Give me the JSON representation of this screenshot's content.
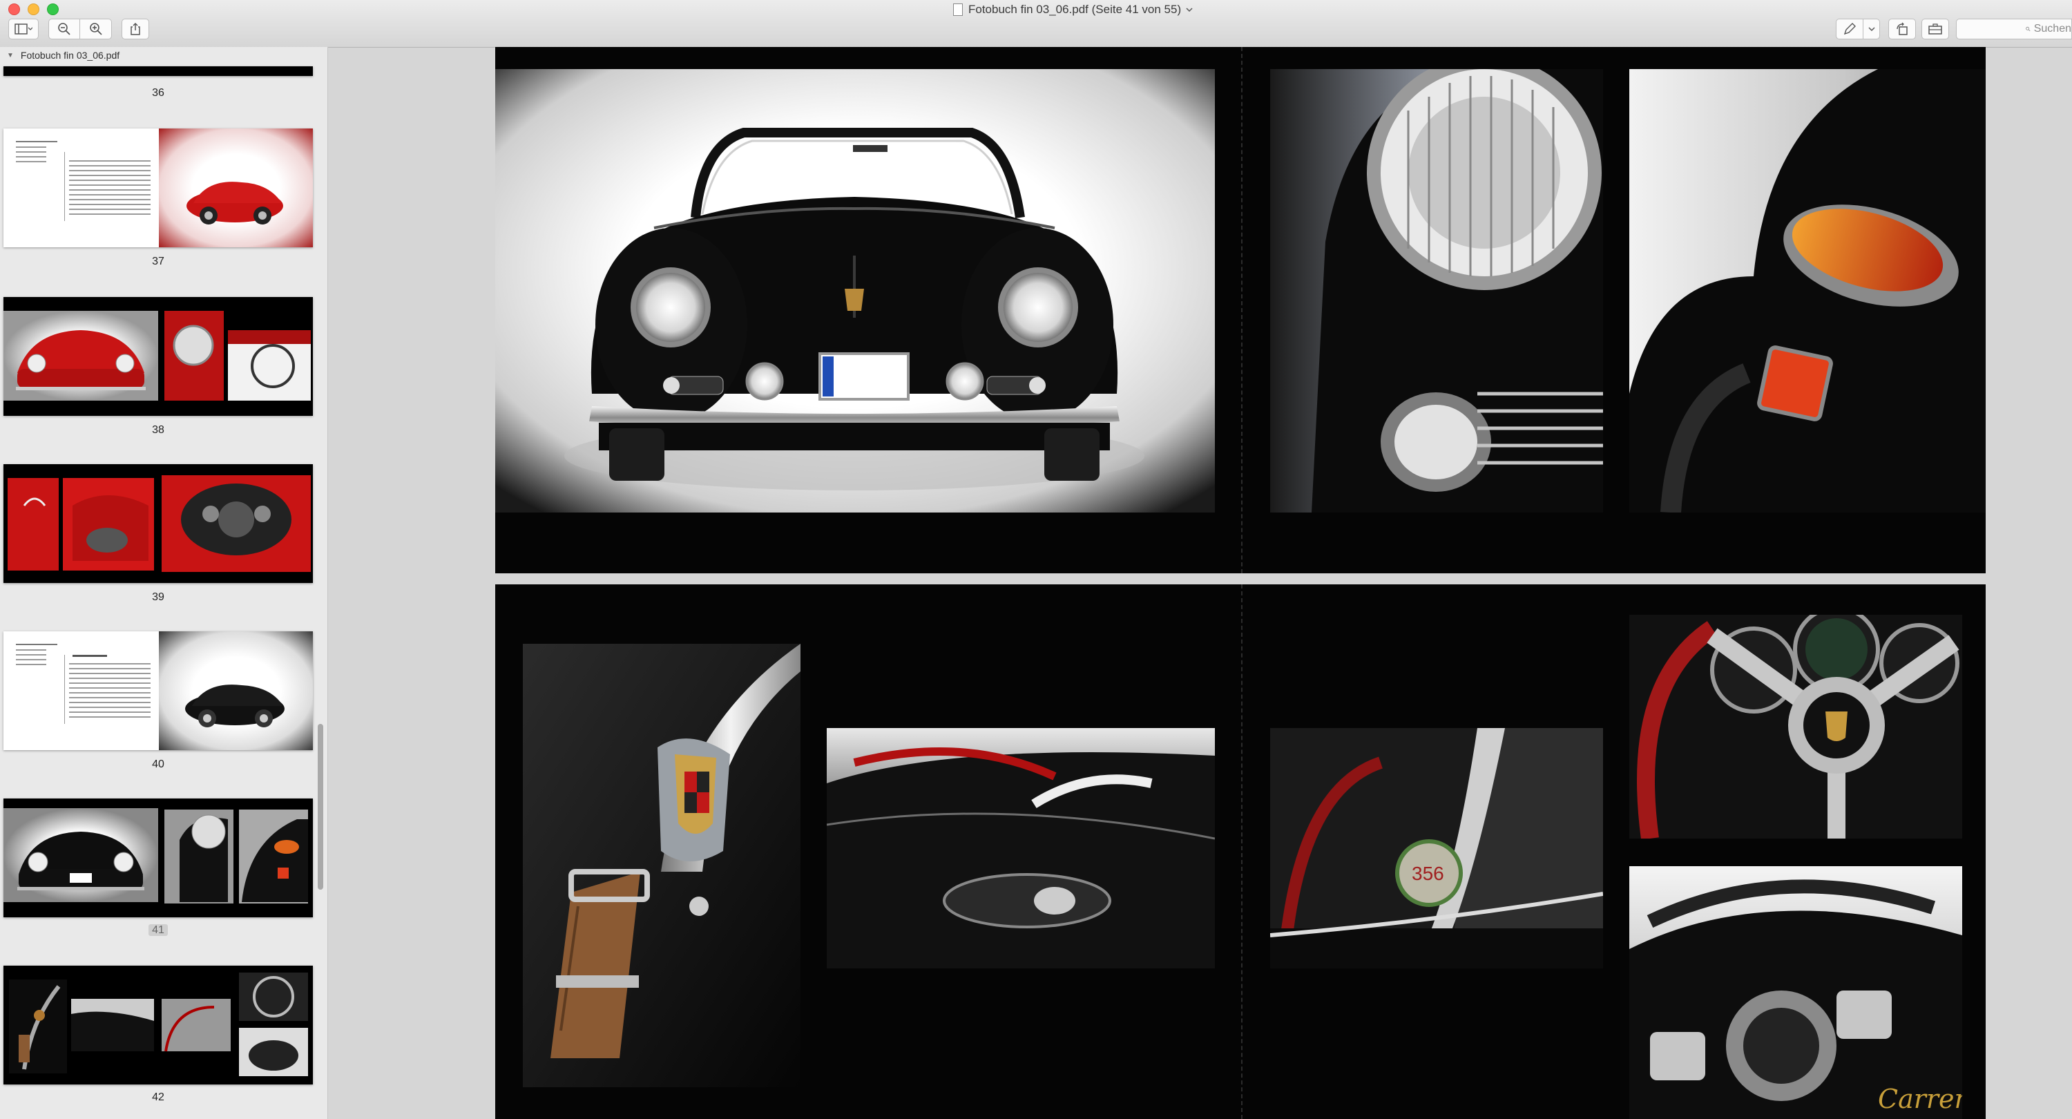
{
  "window": {
    "title": "Fotobuch fin 03_06.pdf (Seite 41 von 55)",
    "title_dropdown_icon": "chevron-down-icon"
  },
  "toolbar": {
    "sidebar_toggle_icon": "sidebar-icon",
    "zoom_out_icon": "zoom-out-icon",
    "zoom_in_icon": "zoom-in-icon",
    "share_icon": "share-icon",
    "markup_icon": "pen-icon",
    "rotate_icon": "rotate-icon",
    "toolbox_icon": "toolbox-icon",
    "search_placeholder": "Suchen",
    "search_icon": "search-icon"
  },
  "sidebar": {
    "document_name": "Fotobuch fin 03_06.pdf",
    "pages": [
      {
        "number": "36",
        "selected": false
      },
      {
        "number": "37",
        "selected": false
      },
      {
        "number": "38",
        "selected": false
      },
      {
        "number": "39",
        "selected": false
      },
      {
        "number": "40",
        "selected": false
      },
      {
        "number": "41",
        "selected": true
      },
      {
        "number": "42",
        "selected": false
      }
    ]
  },
  "colors": {
    "page_background": "#050505",
    "window_background": "#d6d6d6",
    "sidebar_background": "#e9e9e9",
    "car_red": "#c81414",
    "car_black": "#0b0b0b",
    "selection": "#cfcfcf"
  }
}
